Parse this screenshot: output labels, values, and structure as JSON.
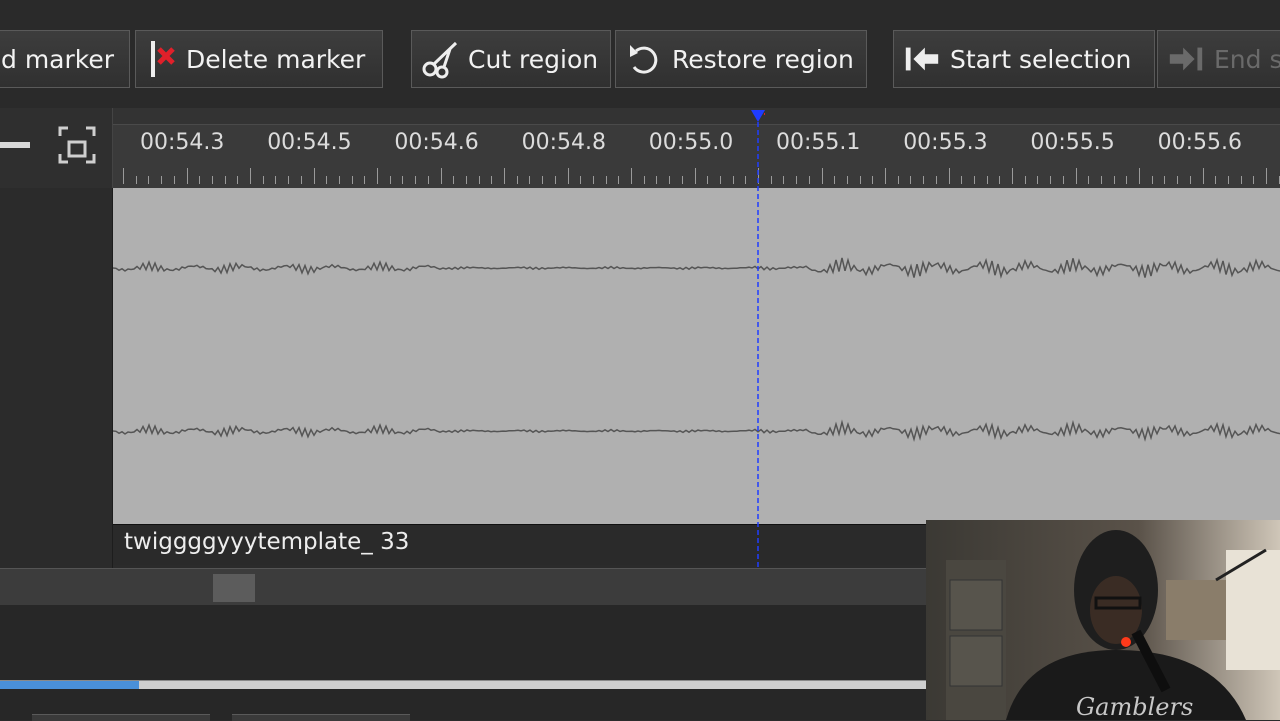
{
  "toolbar": {
    "add_marker_partial": "d marker",
    "delete_marker": "Delete marker",
    "cut_region": "Cut region",
    "restore_region": "Restore region",
    "start_selection": "Start selection",
    "end_selection_partial": "End s"
  },
  "ruler": {
    "labels": [
      "00:54.3",
      "00:54.5",
      "00:54.6",
      "00:54.8",
      "00:55.0",
      "00:55.1",
      "00:55.3",
      "00:55.5",
      "00:55.6"
    ]
  },
  "clip": {
    "name": "twiggggyyytemplate_ 33"
  },
  "progress": {
    "fraction": 0.15
  },
  "colors": {
    "playhead": "#1f3cff",
    "wave_bg": "#b0b0b0",
    "wave_line": "#555555",
    "progress": "#4a90d9"
  },
  "webcam": {
    "shirt_text": "Gamblers"
  }
}
